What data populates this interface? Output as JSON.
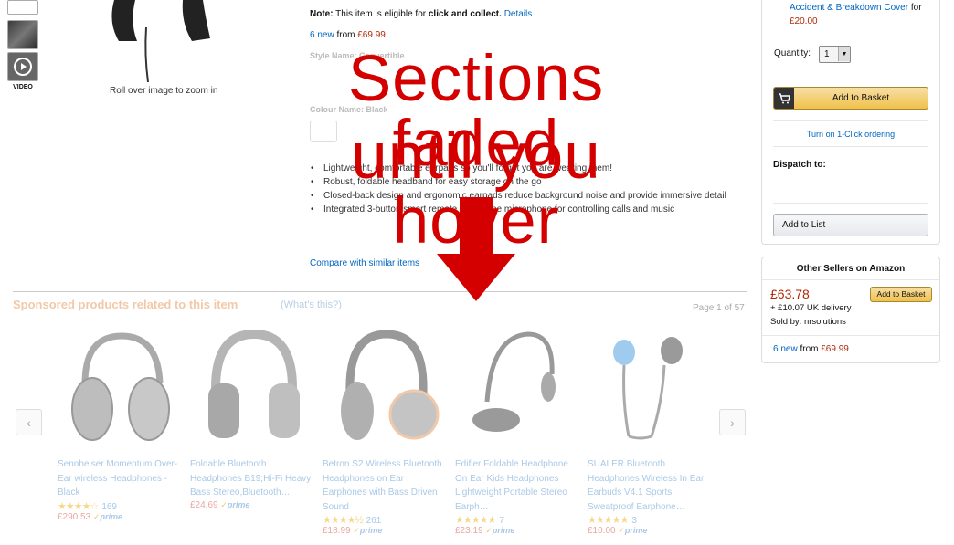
{
  "gallery": {
    "video_label": "VIDEO",
    "zoom_hint": "Roll over image to zoom in"
  },
  "detail": {
    "note_prefix": "Note:",
    "note_text": " This item is eligible for ",
    "note_bold": "click and collect.",
    "note_link": "Details",
    "new_count": "6 new",
    "new_from": "from",
    "new_price": "£69.99",
    "style_label": "Style Name: Convertible",
    "colour_label": "Colour Name: Black",
    "bullets": [
      "Lightweight, comfortable earpads so you'll forget you are wearing them!",
      "Robust, foldable headband for easy storage on the go",
      "Closed-back design and ergonomic earpads reduce background noise and provide immersive detail",
      "Integrated 3-button smart remote and in-line microphone for controlling calls and music"
    ],
    "compare_link": "Compare with similar items"
  },
  "overlay": {
    "line1": "Sections faded",
    "line2": "until you hover",
    "color": "#d40000"
  },
  "buybox": {
    "cover_link": "Accident & Breakdown Cover",
    "cover_for": "for",
    "cover_price": "£20.00",
    "quantity_label": "Quantity:",
    "quantity_value": "1",
    "add_to_basket": "Add to Basket",
    "one_click": "Turn on 1-Click ordering",
    "dispatch_to": "Dispatch to:",
    "add_to_list": "Add to List"
  },
  "other_sellers": {
    "title": "Other Sellers on Amazon",
    "price": "£63.78",
    "delivery": "+ £10.07 UK delivery",
    "sold_by": "Sold by: nrsolutions",
    "basket_button": "Add to Basket",
    "new_count": "6 new",
    "new_from": "from",
    "new_price": "£69.99"
  },
  "sponsored": {
    "title": "Sponsored products related to this item",
    "whats_this": "(What's this?)",
    "page": "Page 1 of 57",
    "prev_icon": "chevron-left-icon",
    "next_icon": "chevron-right-icon",
    "products": [
      {
        "title": "Sennheiser Momentum Over-Ear wireless Headphones - Black",
        "stars": "★★★★☆",
        "rating": 4,
        "reviews": "169",
        "price": "£290.53",
        "prime": "prime"
      },
      {
        "title": "Foldable Bluetooth Headphones B19;Hi-Fi Heavy Bass Stereo,Bluetooth…",
        "stars": "",
        "rating": 0,
        "reviews": "",
        "price": "£24.69",
        "prime": "prime"
      },
      {
        "title": "Betron S2 Wireless Bluetooth Headphones on Ear Earphones with Bass Driven Sound",
        "stars": "★★★★½",
        "rating": 4.5,
        "reviews": "261",
        "price": "£18.99",
        "prime": "prime"
      },
      {
        "title": "Edifier Foldable Headphone On Ear Kids Headphones Lightweight Portable Stereo Earph…",
        "stars": "★★★★★",
        "rating": 5,
        "reviews": "7",
        "price": "£23.19",
        "prime": "prime"
      },
      {
        "title": "SUALER Bluetooth Headphones Wireless In Ear Earbuds V4.1 Sports Sweatproof Earphone…",
        "stars": "★★★★★",
        "rating": 5,
        "reviews": "3",
        "price": "£10.00",
        "prime": "prime"
      }
    ]
  }
}
